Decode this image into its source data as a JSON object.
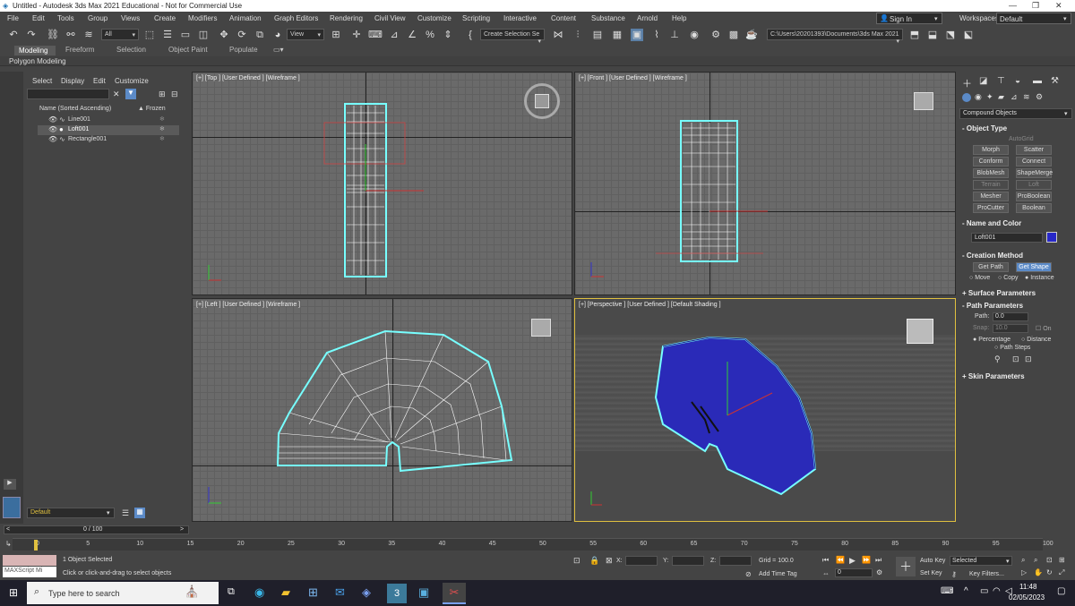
{
  "window": {
    "title": "Untitled - Autodesk 3ds Max 2021 Educational - Not for Commercial Use"
  },
  "menu": [
    "File",
    "Edit",
    "Tools",
    "Group",
    "Views",
    "Create",
    "Modifiers",
    "Animation",
    "Graph Editors",
    "Rendering",
    "Civil View",
    "Customize",
    "Scripting",
    "Interactive",
    "Content",
    "Substance",
    "Arnold",
    "Help"
  ],
  "account": {
    "sign_in": "Sign In",
    "workspaces_label": "Workspaces:",
    "workspace": "Default"
  },
  "toolbar": {
    "filter": "All",
    "ref_coord": "View",
    "selection_set": "Create Selection Se",
    "path": "C:\\Users\\20201393\\Documents\\3ds Max 2021"
  },
  "ribbon": {
    "tabs": [
      "Modeling",
      "Freeform",
      "Selection",
      "Object Paint",
      "Populate"
    ],
    "sub": "Polygon Modeling"
  },
  "scene_explorer": {
    "tabs": [
      "Select",
      "Display",
      "Edit",
      "Customize"
    ],
    "col_name": "Name (Sorted Ascending)",
    "col_frozen": "▲ Frozen",
    "items": [
      "Line001",
      "Loft001",
      "Rectangle001"
    ],
    "layer": "Default"
  },
  "viewports": {
    "top": "[+] [Top ] [User Defined ] [Wireframe ]",
    "front": "[+] [Front ] [User Defined ] [Wireframe ]",
    "left": "[+] [Left ] [User Defined ] [Wireframe ]",
    "perspective": "[+] [Perspective ] [User Defined ] [Default Shading ]"
  },
  "command_panel": {
    "category": "Compound Objects",
    "object_type": {
      "title": "Object Type",
      "autogrid": "AutoGrid",
      "buttons": [
        "Morph",
        "Scatter",
        "Conform",
        "Connect",
        "BlobMesh",
        "ShapeMerge",
        "Terrain",
        "Loft",
        "Mesher",
        "ProBoolean",
        "ProCutter",
        "Boolean"
      ]
    },
    "name_color": {
      "title": "Name and Color",
      "name": "Loft001",
      "color": "#2828c8"
    },
    "creation": {
      "title": "Creation Method",
      "get_path": "Get Path",
      "get_shape": "Get Shape",
      "options": [
        "Move",
        "Copy",
        "Instance"
      ]
    },
    "surface": "Surface Parameters",
    "path": {
      "title": "Path Parameters",
      "path_label": "Path:",
      "path_value": "0.0",
      "snap_label": "Snap:",
      "snap_value": "10.0",
      "on": "On",
      "percentage": "Percentage",
      "distance": "Distance",
      "path_steps": "Path Steps"
    },
    "skin": "Skin Parameters"
  },
  "timeline": {
    "frame": "0 / 100",
    "ticks": [
      "0",
      "5",
      "10",
      "15",
      "20",
      "25",
      "30",
      "35",
      "40",
      "45",
      "50",
      "55",
      "60",
      "65",
      "70",
      "75",
      "80",
      "85",
      "90",
      "95",
      "100"
    ]
  },
  "status": {
    "maxscript": "MAXScript Mi",
    "selected": "1 Object Selected",
    "prompt": "Click or click-and-drag to select objects",
    "x": "X:",
    "y": "Y:",
    "z": "Z:",
    "grid": "Grid = 100.0",
    "add_time_tag": "Add Time Tag",
    "auto_key": "Auto Key",
    "set_key": "Set Key",
    "key_mode": "Selected",
    "key_filters": "Key Filters...",
    "frame_field": "0"
  },
  "taskbar": {
    "search": "Type here to search",
    "time": "11:48",
    "date": "02/05/2023"
  }
}
